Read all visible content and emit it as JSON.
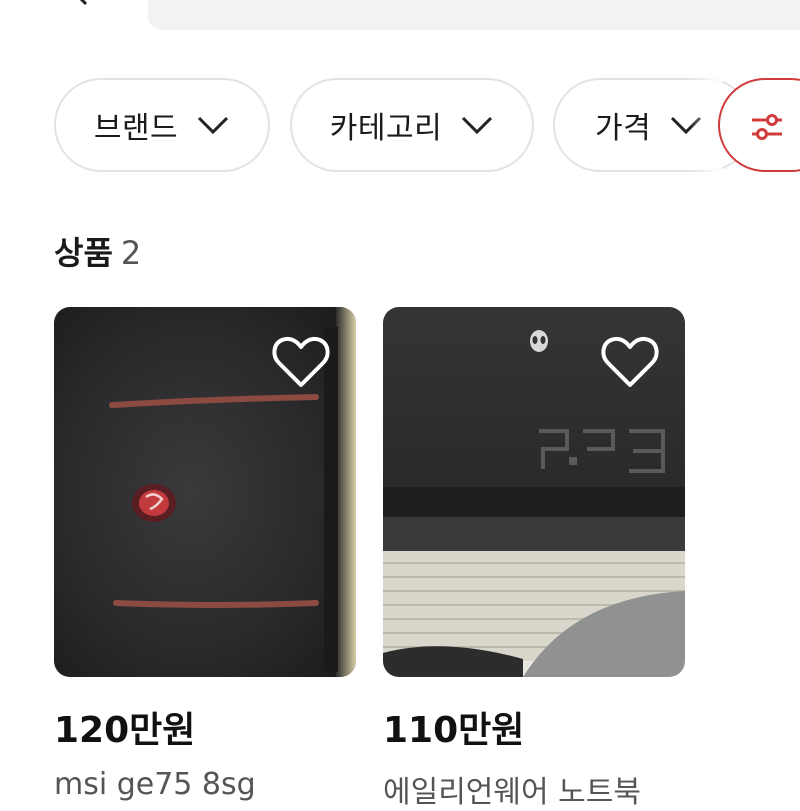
{
  "filters": [
    {
      "label": "브랜드"
    },
    {
      "label": "카테고리"
    },
    {
      "label": "가격"
    }
  ],
  "section": {
    "title": "상품",
    "count": "2"
  },
  "products": [
    {
      "price": "120만원",
      "title": "msi ge75 8sg"
    },
    {
      "price": "110만원",
      "title": "에일리언웨어 노트북"
    }
  ],
  "colors": {
    "accent": "#d23b3b",
    "chip_border": "#e3e3e3",
    "search_bg": "#f2f2f2"
  },
  "icons": [
    "back-icon",
    "chevron-down-icon",
    "filter-settings-icon",
    "heart-icon"
  ]
}
